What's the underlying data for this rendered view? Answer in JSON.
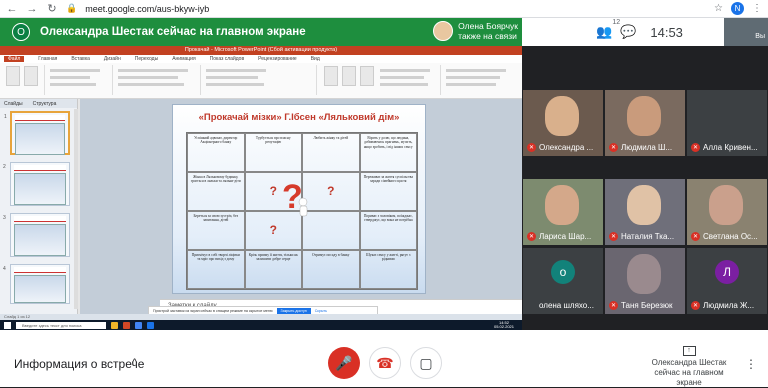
{
  "browser": {
    "url": "meet.google.com/aus-bkyw-iyb",
    "profile_initial": "N",
    "back": "←",
    "forward": "→",
    "reload": "↻",
    "lock": "🔒",
    "star": "☆",
    "menu": "⋮"
  },
  "meet_header": {
    "presenter_initial": "О",
    "presenting_text": "Олександра Шестак сейчас на главном экране",
    "active_speaker_name": "Олена Боярчук",
    "active_speaker_status": "также на связи",
    "people_count": "12",
    "time": "14:53",
    "self_label": "Вы"
  },
  "ppt": {
    "window_title": "Прокачай - Microsoft PowerPoint (Сбой активации продукта)",
    "tabs": [
      "Файл",
      "Главная",
      "Вставка",
      "Дизайн",
      "Переходы",
      "Анимация",
      "Показ слайдов",
      "Рецензирование",
      "Вид"
    ],
    "panel_tabs": [
      "Слайды",
      "Структура"
    ],
    "slide_numbers": [
      "1",
      "2",
      "3",
      "4",
      "5"
    ],
    "notes_placeholder": "Заметки к слайду",
    "status": "Слайд 1 из 12",
    "notice_text": "Пристрой заставок из экран сейчас в спящем режиме на скрытое меню",
    "notice_button": "Закрыть доступ",
    "notice_link": "Скрыть",
    "taskbar_search": "Введите здесь текст для поиска",
    "taskbar_time": "14:52",
    "taskbar_date": "05.02.2021"
  },
  "slide": {
    "title_part1": "«Прокачай мізки»",
    "title_part2": " Г.Ібсен «Ляльковий дім»",
    "cells": [
      "Успішний адвокат, директор Акціонерного банку",
      "Турбується про власну репутацію",
      "Любить жінку та дітей",
      "Вірить у долю, що людина, добиваючись прагнень, мусить, якщо зробить, і від інших сенсу",
      "Жінка в Ляльковому будинку, грається в ляльки та ляльки-діти",
      "?",
      "?",
      "Переживає за життя суспільства заради сімейного щастя",
      "Береться за свою зустріч, без запитання, дітей",
      "?",
      "",
      "Пориває з чоловіком, поїжджає, стверджує, що вона не потрібна",
      "Пригнічує в собі творчі ліцівки та мріє про вихід з дому",
      "Крізь призму її життя, тільки як залишити добре серце",
      "Отримує посаду в банку",
      "Шукає сенсу у житті, рятує з рідними"
    ]
  },
  "participants": [
    {
      "name": "Олександра ...",
      "initial": "",
      "color": "#6b5a4e",
      "face": "#d9b08c",
      "muted": true
    },
    {
      "name": "Людмила Ш...",
      "initial": "",
      "color": "#7a6a5f",
      "face": "#c99b7c",
      "muted": true
    },
    {
      "name": "Алла Кривен...",
      "initial": "",
      "color": "#3c4043",
      "face": "",
      "muted": true
    },
    {
      "name": "Лариса Шар...",
      "initial": "",
      "color": "#7d8b6f",
      "face": "#d4a88a",
      "muted": true
    },
    {
      "name": "Наталия Тка...",
      "initial": "",
      "color": "#6f6f7a",
      "face": "#e0c2a6",
      "muted": true
    },
    {
      "name": "Светлана Ос...",
      "initial": "",
      "color": "#8a8270",
      "face": "#caa08c",
      "muted": true
    },
    {
      "name": "олена шляхо...",
      "initial": "о",
      "color": "#3c4043",
      "face": "",
      "muted": false
    },
    {
      "name": "Таня Березюк",
      "initial": "",
      "color": "#6a6670",
      "face": "#9a8a8e",
      "muted": true
    },
    {
      "name": "Людмила Ж...",
      "initial": "Л",
      "color": "#3c4043",
      "face": "",
      "muted": true
    }
  ],
  "bottom_bar": {
    "info_label": "Информация о встрече",
    "chevron": "^",
    "mic_icon": "🎤",
    "end_icon": "☎",
    "cam_icon": "▢",
    "present_icon": "↑",
    "present_label_1": "Олександра Шестак",
    "present_label_2": "сейчас на главном экране",
    "more": "⋮"
  },
  "colors": {
    "presenting_banner": "#1e8e3e",
    "mute_red": "#d93025",
    "slide_title": "#c0392b"
  }
}
